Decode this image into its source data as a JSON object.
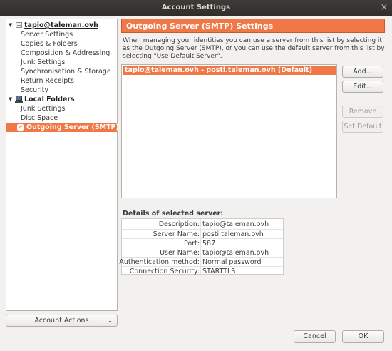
{
  "window": {
    "title": "Account Settings",
    "close_glyph": "×"
  },
  "sidebar": {
    "account": {
      "name": "tapio@taleman.ovh",
      "icon": "account-icon"
    },
    "account_items": [
      "Server Settings",
      "Copies & Folders",
      "Composition & Addressing",
      "Junk Settings",
      "Synchronisation & Storage",
      "Return Receipts",
      "Security"
    ],
    "local": {
      "name": "Local Folders",
      "icon": "computer-icon"
    },
    "local_items": [
      "Junk Settings",
      "Disc Space"
    ],
    "smtp": {
      "label": "Outgoing Server (SMTP)",
      "icon": "outgoing-mail-icon"
    }
  },
  "account_actions": {
    "label": "Account Actions"
  },
  "main": {
    "title": "Outgoing Server (SMTP) Settings",
    "description": "When managing your identities you can use a server from this list by selecting it as the Outgoing Server (SMTP), or you can use the default server from this list by selecting \"Use Default Server\".",
    "servers": [
      "tapio@taleman.ovh - posti.taleman.ovh (Default)"
    ],
    "buttons": {
      "add": "Add...",
      "edit": "Edit...",
      "remove": "Remove",
      "set_default": "Set Default"
    },
    "details": {
      "title": "Details of selected server:",
      "rows": [
        {
          "label": "Description:",
          "value": "tapio@taleman.ovh"
        },
        {
          "label": "Server Name:",
          "value": "posti.taleman.ovh"
        },
        {
          "label": "Port:",
          "value": "587"
        },
        {
          "label": "User Name:",
          "value": "tapio@taleman.ovh"
        },
        {
          "label": "Authentication method:",
          "value": "Normal password"
        },
        {
          "label": "Connection Security:",
          "value": "STARTTLS"
        }
      ]
    }
  },
  "footer": {
    "cancel": "Cancel",
    "ok": "OK"
  },
  "colors": {
    "accent": "#f07746",
    "titlebar": "#2f2e2b",
    "background": "#f2f1f0"
  }
}
